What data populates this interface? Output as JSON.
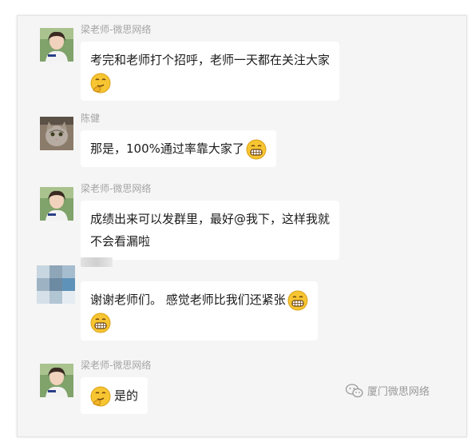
{
  "messages": [
    {
      "sender": "梁老师-微思网络",
      "lines": [
        "考完和老师打个招呼，老师一天都在关注大家"
      ],
      "emoji": "thinking-emoji"
    },
    {
      "sender": "陈健",
      "lines": [
        "那是，100%通过率靠大家了"
      ],
      "emoji": "grin-emoji"
    },
    {
      "sender": "梁老师-微思网络",
      "lines": [
        "成绩出来可以发群里，最好@我下，这样我就",
        "不会看漏啦"
      ]
    },
    {
      "sender": "",
      "lines": [
        "谢谢老师们。 感觉老师比我们还紧张"
      ],
      "emoji": "grin-emoji"
    },
    {
      "sender": "梁老师-微思网络",
      "lines": [
        "是的"
      ],
      "emoji": "thinking-emoji"
    }
  ],
  "watermark": "厦门微思网络",
  "colors": {
    "chat_background": "#f5f5f5",
    "bubble": "#ffffff",
    "sender_name": "#a4a4a4",
    "emoji_face": "#f7c531"
  }
}
